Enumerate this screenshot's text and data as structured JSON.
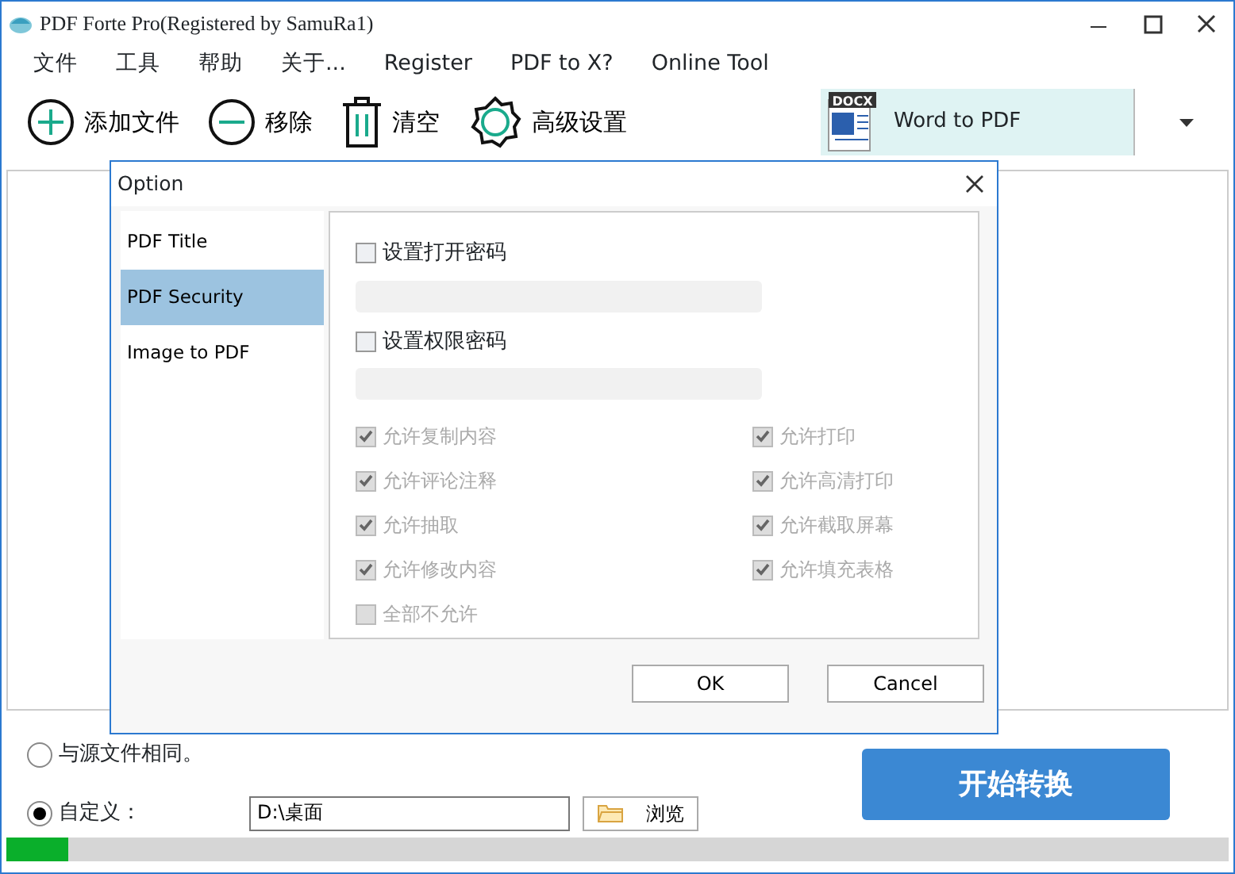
{
  "window": {
    "title": "PDF Forte Pro(Registered by SamuRa1)"
  },
  "menu": [
    "文件",
    "工具",
    "帮助",
    "关于...",
    "Register",
    "PDF to X?",
    "Online Tool"
  ],
  "toolbar": [
    {
      "kind": "add",
      "label": "添加文件"
    },
    {
      "kind": "remove",
      "label": "移除"
    },
    {
      "kind": "clear",
      "label": "清空"
    },
    {
      "kind": "settings",
      "label": "高级设置"
    }
  ],
  "mode_select": {
    "badge": "DOCX",
    "value": "Word to PDF"
  },
  "output": {
    "options": [
      {
        "label": "与源文件相同。",
        "selected": false
      },
      {
        "label": "自定义：",
        "selected": true
      }
    ],
    "path": "D:\\桌面",
    "browse": "浏览"
  },
  "start_button": "开始转换",
  "progress": {
    "level": 0.05
  },
  "dialog": {
    "title": "Option",
    "tabs": [
      {
        "label": "PDF Title",
        "selected": false
      },
      {
        "label": "PDF Security",
        "selected": true
      },
      {
        "label": "Image to PDF",
        "selected": false
      }
    ],
    "passwords": [
      {
        "label": "设置打开密码",
        "checked": false
      },
      {
        "label": "设置权限密码",
        "checked": false
      }
    ],
    "permissions": [
      {
        "label": "允许复制内容",
        "checked": true,
        "disabled": true
      },
      {
        "label": "允许打印",
        "checked": true,
        "disabled": true
      },
      {
        "label": "允许评论注释",
        "checked": true,
        "disabled": true
      },
      {
        "label": "允许高清打印",
        "checked": true,
        "disabled": true
      },
      {
        "label": "允许抽取",
        "checked": true,
        "disabled": true
      },
      {
        "label": "允许截取屏幕",
        "checked": true,
        "disabled": true
      },
      {
        "label": "允许修改内容",
        "checked": true,
        "disabled": true
      },
      {
        "label": "允许填充表格",
        "checked": true,
        "disabled": true
      },
      {
        "label": "全部不允许",
        "checked": false,
        "disabled": true
      }
    ],
    "buttons": [
      "OK",
      "Cancel"
    ]
  }
}
